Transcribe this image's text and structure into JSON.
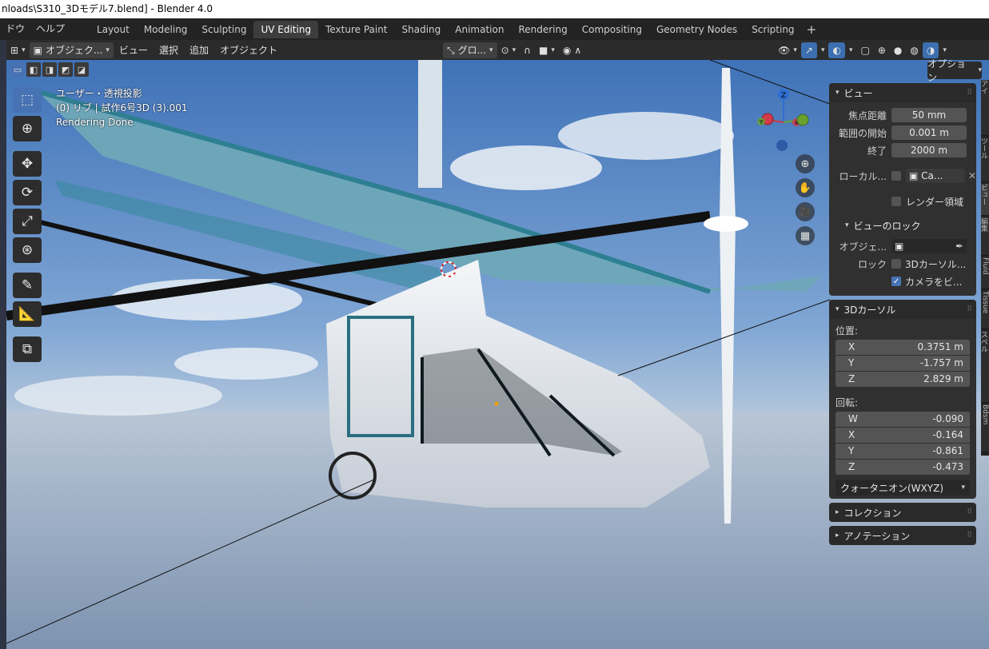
{
  "window": {
    "title": "nloads\\S310_3Dモデル7.blend] - Blender 4.0"
  },
  "topbar": {
    "menus": [
      "ドウ",
      "ヘルプ"
    ],
    "tabs": [
      "Layout",
      "Modeling",
      "Sculpting",
      "UV Editing",
      "Texture Paint",
      "Shading",
      "Animation",
      "Rendering",
      "Compositing",
      "Geometry Nodes",
      "Scripting"
    ],
    "active_tab": "UV Editing",
    "add_tab": "+"
  },
  "viewport_header": {
    "mode_label": "オブジェク...",
    "menus": [
      "ビュー",
      "選択",
      "追加",
      "オブジェクト"
    ],
    "transform_orientation": "グロ...",
    "options_label": "オプション"
  },
  "overlay": {
    "line1": "ユーザー・透視投影",
    "line2": "(0) リブ | 試作6号3D (3).001",
    "line3": "Rendering Done"
  },
  "gizmo": {
    "z": "Z",
    "x": "X",
    "y": "Y"
  },
  "colors": {
    "accent": "#4772b3",
    "panel": "#303030",
    "field": "#545454",
    "axis_x": "#d23a4a",
    "axis_y": "#6aa12e",
    "axis_z": "#2f6fd1"
  },
  "view_panel": {
    "title": "ビュー",
    "focal_label": "焦点距離",
    "focal_value": "50 mm",
    "clip_start_label": "範囲の開始",
    "clip_start_value": "0.001 m",
    "clip_end_label": "終了",
    "clip_end_value": "2000 m",
    "local_camera_label": "ローカル...",
    "local_camera_value": "Ca...",
    "render_region_label": "レンダー領域",
    "view_lock": {
      "title": "ビューのロック",
      "object_label": "オブジェ...",
      "lock_label": "ロック",
      "lock_cursor_label": "3Dカーソル...",
      "lock_camera_label": "カメラをビ..."
    }
  },
  "cursor_panel": {
    "title": "3Dカーソル",
    "location_label": "位置:",
    "location": [
      {
        "axis": "X",
        "value": "0.3751 m"
      },
      {
        "axis": "Y",
        "value": "-1.757 m"
      },
      {
        "axis": "Z",
        "value": "2.829 m"
      }
    ],
    "rotation_label": "回転:",
    "rotation": [
      {
        "axis": "W",
        "value": "-0.090"
      },
      {
        "axis": "X",
        "value": "-0.164"
      },
      {
        "axis": "Y",
        "value": "-0.861"
      },
      {
        "axis": "Z",
        "value": "-0.473"
      }
    ],
    "rotation_mode": "クォータニオン(WXYZ)"
  },
  "collections_panel": {
    "title": "コレクション"
  },
  "annotations_panel": {
    "title": "アノテーション"
  },
  "sidebar_tabs": [
    "アイ",
    "ツール",
    "ビュー",
    "編集",
    "Fluid",
    "Tissue",
    "スペル",
    "Bdsm"
  ]
}
